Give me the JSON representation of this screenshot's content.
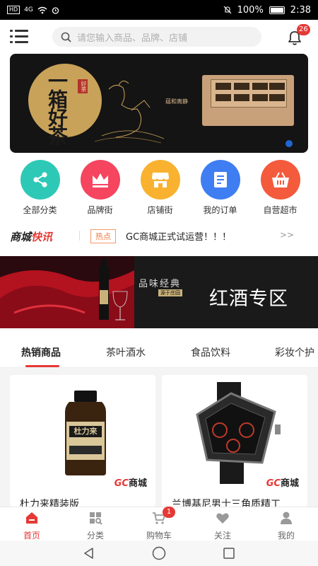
{
  "status_bar": {
    "left_icons": [
      "HD",
      "4G",
      "wifi-icon",
      "alarm-icon"
    ],
    "battery_percent": 100,
    "battery_label": "100%",
    "time": "2:38"
  },
  "header": {
    "search_placeholder": "请您输入商品、品牌、店铺",
    "notification_count": "26"
  },
  "banner": {
    "brand_text": "一箱好茶",
    "stamp_text": "好茶",
    "product_subtitle": "蕴和离静",
    "pagination_active": 1
  },
  "categories": [
    {
      "label": "全部分类",
      "color": "#2ec9b6",
      "icon": "share-icon"
    },
    {
      "label": "品牌街",
      "color": "#f5455f",
      "icon": "crown-icon"
    },
    {
      "label": "店铺街",
      "color": "#f8b230",
      "icon": "store-icon"
    },
    {
      "label": "我的订单",
      "color": "#3f7df2",
      "icon": "order-icon"
    },
    {
      "label": "自营超市",
      "color": "#f45a3c",
      "icon": "basket-icon"
    }
  ],
  "news": {
    "brand_prefix": "商城",
    "brand_suffix": "快讯",
    "tag": "热点",
    "text": "GC商城正式试运营！！！",
    "more": ">>"
  },
  "wine_banner": {
    "slogan": "品味经典",
    "slogan_sub": "源于庄园",
    "title": "红酒专区"
  },
  "tabs": [
    {
      "label": "热销商品",
      "active": true
    },
    {
      "label": "茶叶酒水",
      "active": false
    },
    {
      "label": "食品饮料",
      "active": false
    },
    {
      "label": "彩妆个护",
      "active": false
    }
  ],
  "products": [
    {
      "name": "杜力来精装版",
      "logo_prefix": "GC",
      "logo_suffix": "商城",
      "bottle_label": "杜力来"
    },
    {
      "name": "兰博基尼男士三角质精工",
      "logo_prefix": "GC",
      "logo_suffix": "商城"
    }
  ],
  "bottom_nav": [
    {
      "label": "首页",
      "icon": "home-icon",
      "active": true
    },
    {
      "label": "分类",
      "icon": "category-icon",
      "active": false
    },
    {
      "label": "购物车",
      "icon": "cart-icon",
      "active": false,
      "badge": "1"
    },
    {
      "label": "关注",
      "icon": "heart-icon",
      "active": false
    },
    {
      "label": "我的",
      "icon": "user-icon",
      "active": false
    }
  ],
  "colors": {
    "accent": "#e53935",
    "tag_orange": "#f07840"
  }
}
